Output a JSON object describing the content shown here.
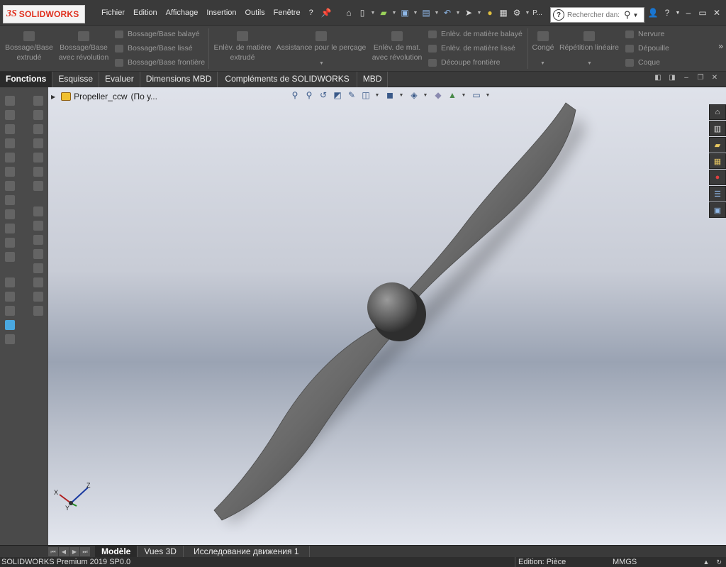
{
  "app": {
    "logo_ds": "3S",
    "logo_name": "SOLIDWORKS"
  },
  "menu": [
    "Fichier",
    "Edition",
    "Affichage",
    "Insertion",
    "Outils",
    "Fenêtre",
    "?"
  ],
  "quick_access": {
    "overflow_label": "P..."
  },
  "search": {
    "placeholder": "Rechercher dan:"
  },
  "ribbon": {
    "extrude_l1": "Bossage/Base",
    "extrude_l2": "extrudé",
    "revolve_l1": "Bossage/Base",
    "revolve_l2": "avec révolution",
    "sweep": "Bossage/Base balayé",
    "loft": "Bossage/Base lissé",
    "boundary": "Bossage/Base frontière",
    "cut_extrude_l1": "Enlèv. de matière",
    "cut_extrude_l2": "extrudé",
    "hole_wizard": "Assistance pour le perçage",
    "cut_revolve_l1": "Enlèv. de mat.",
    "cut_revolve_l2": "avec révolution",
    "swept_cut": "Enlèv. de matière balayé",
    "lofted_cut": "Enlèv. de matière lissé",
    "boundary_cut": "Découpe frontière",
    "fillet": "Congé",
    "linear_pattern": "Répétition linéaire",
    "rib": "Nervure",
    "draft": "Dépouille",
    "shell": "Coque"
  },
  "tabs": [
    "Fonctions",
    "Esquisse",
    "Evaluer",
    "Dimensions MBD",
    "Compléments de SOLIDWORKS",
    "MBD"
  ],
  "tree": {
    "part_name": "Propeller_ccw",
    "config": "(По у..."
  },
  "triad": {
    "x": "X",
    "y": "Y",
    "z": "Z"
  },
  "bottom_tabs": [
    "Modèle",
    "Vues 3D",
    "Исследование движения 1"
  ],
  "status": {
    "product": "SOLIDWORKS Premium 2019 SP0.0",
    "mode": "Edition: Pièce",
    "units": "MMGS"
  },
  "colors": {
    "logo_red": "#e0301e",
    "background_top": "#dfe2ea",
    "background_mid": "#9aa3b3",
    "part_gray": "#6e6e6e"
  }
}
